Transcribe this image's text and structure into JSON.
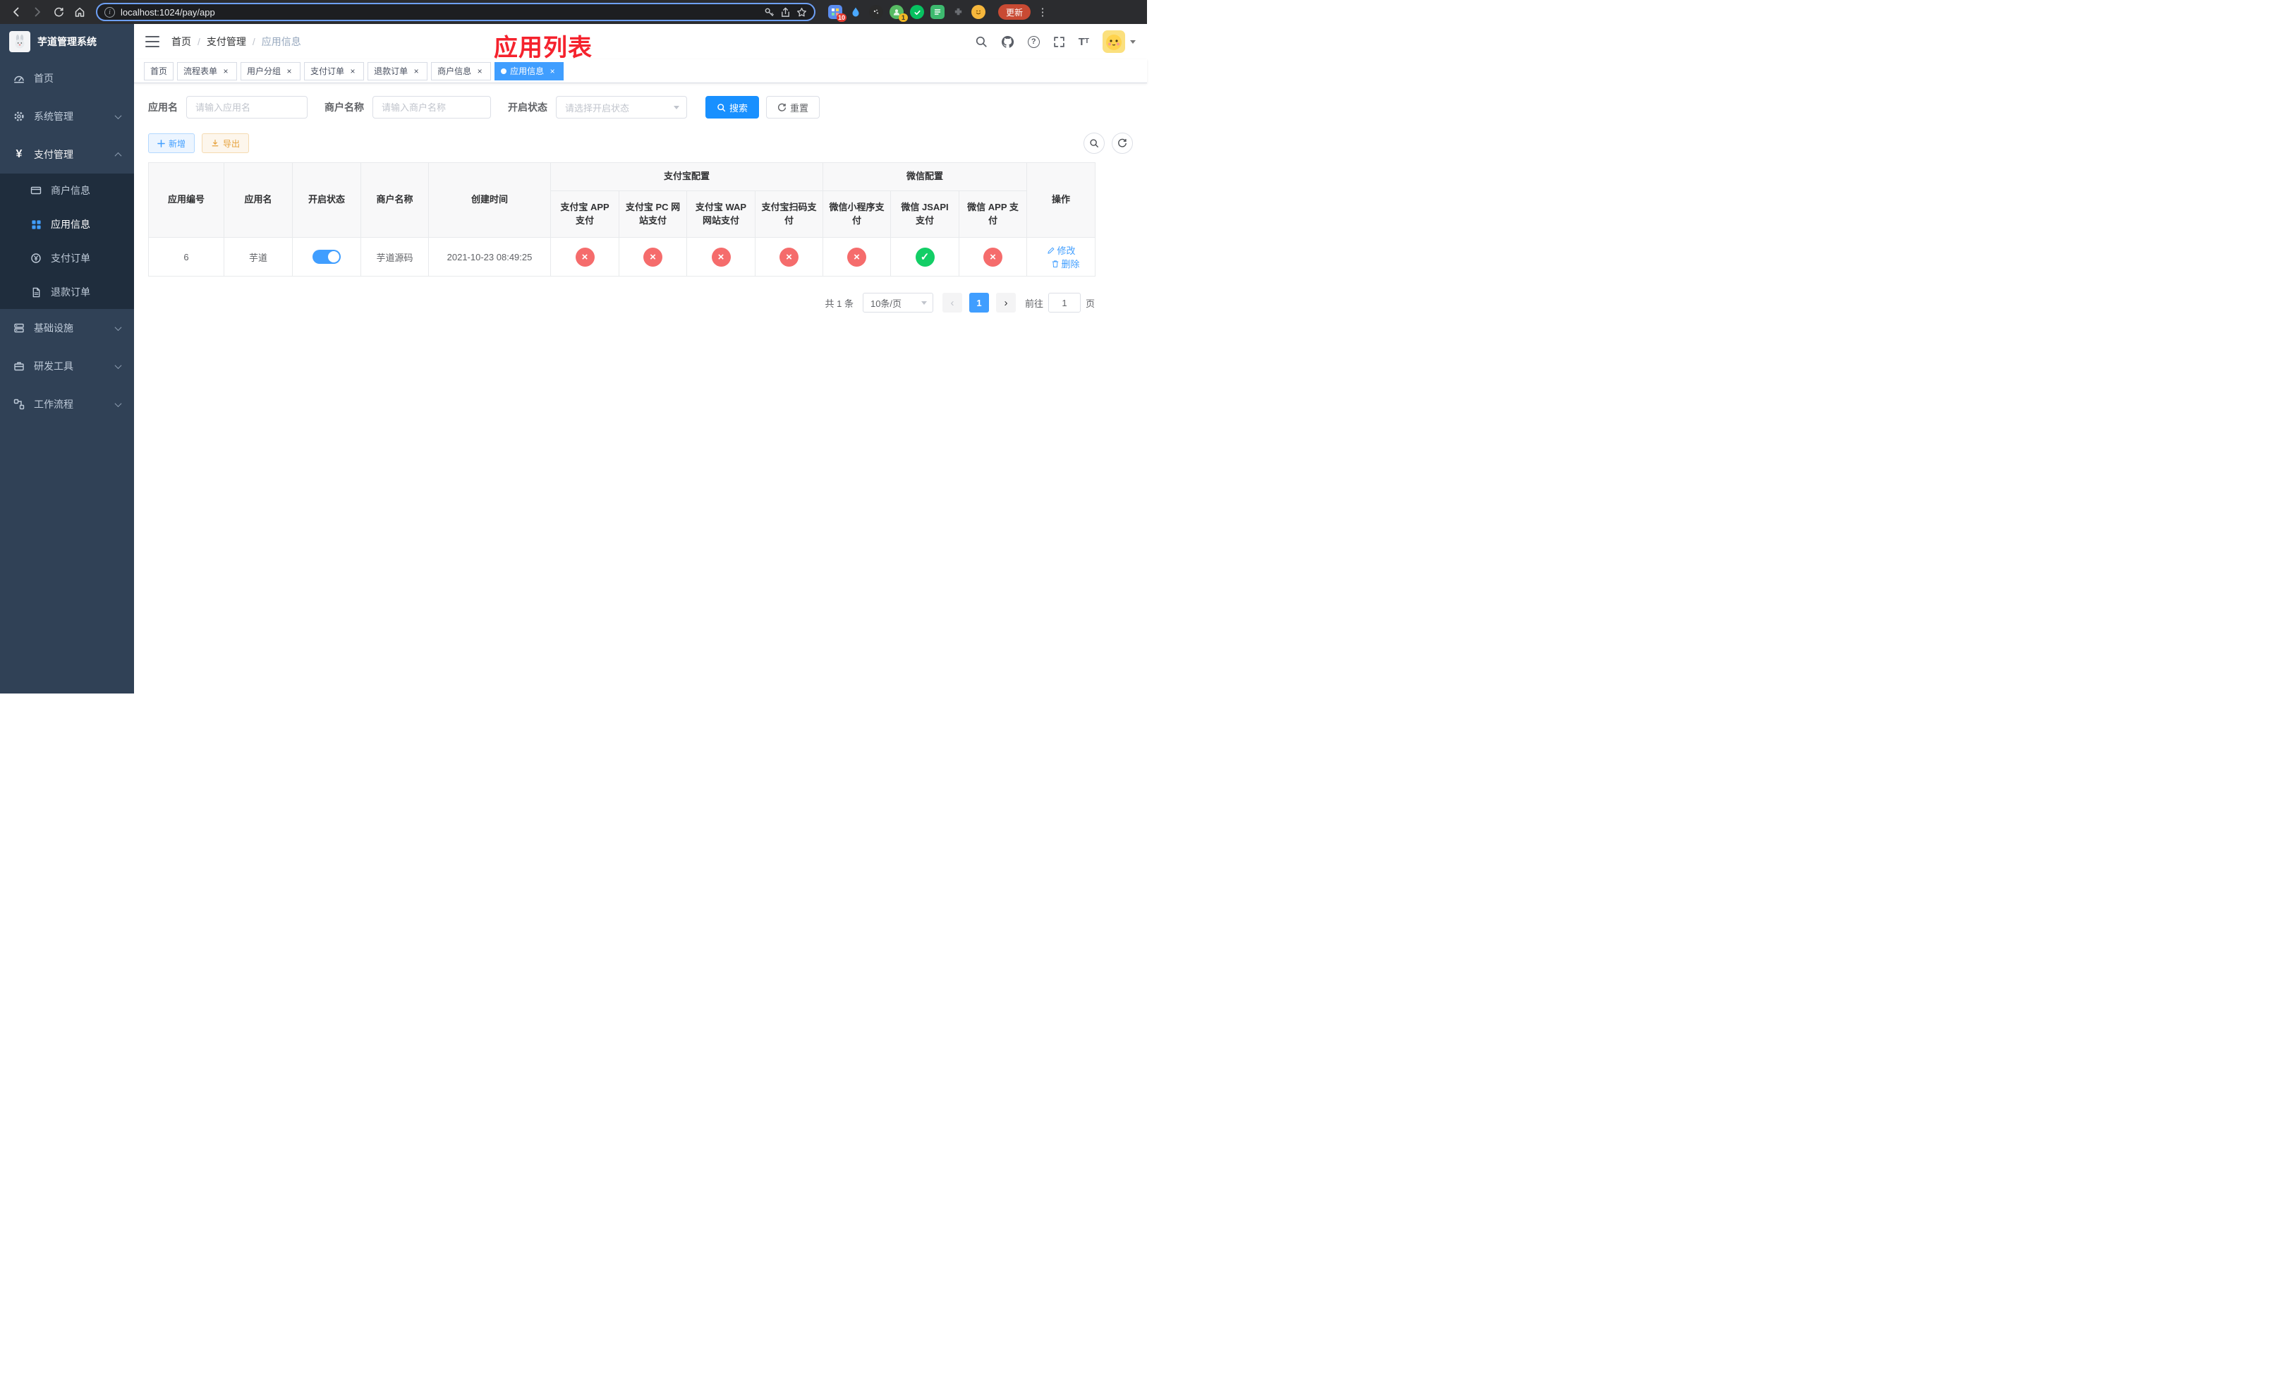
{
  "browser": {
    "url": "localhost:1024/pay/app",
    "update_label": "更新",
    "extension_badges": {
      "grid": "10",
      "avatar": "1"
    },
    "icons": [
      "back",
      "forward",
      "refresh",
      "home",
      "info",
      "key",
      "share",
      "bookmark-star",
      "extensions",
      "menu-kebab"
    ]
  },
  "sidebar": {
    "logo_title": "芋道管理系统",
    "menu": [
      {
        "label": "首页"
      },
      {
        "label": "系统管理"
      },
      {
        "label": "支付管理"
      },
      {
        "label": "商户信息"
      },
      {
        "label": "应用信息"
      },
      {
        "label": "支付订单"
      },
      {
        "label": "退款订单"
      },
      {
        "label": "基础设施"
      },
      {
        "label": "研发工具"
      },
      {
        "label": "工作流程"
      }
    ]
  },
  "header": {
    "breadcrumb": [
      "首页",
      "支付管理",
      "应用信息"
    ],
    "page_title": "应用列表",
    "right_icons": [
      "search",
      "github",
      "help",
      "fullscreen",
      "font-size",
      "avatar",
      "chevron-down"
    ]
  },
  "tabs": [
    {
      "label": "首页"
    },
    {
      "label": "流程表单"
    },
    {
      "label": "用户分组"
    },
    {
      "label": "支付订单"
    },
    {
      "label": "退款订单"
    },
    {
      "label": "商户信息"
    },
    {
      "label": "应用信息"
    }
  ],
  "filters": {
    "app_name_label": "应用名",
    "app_name_placeholder": "请输入应用名",
    "merchant_label": "商户名称",
    "merchant_placeholder": "请输入商户名称",
    "status_label": "开启状态",
    "status_placeholder": "请选择开启状态",
    "search_label": "搜索",
    "reset_label": "重置"
  },
  "toolbar": {
    "add_label": "新增",
    "export_label": "导出"
  },
  "table": {
    "groups": {
      "alipay": "支付宝配置",
      "wechat": "微信配置"
    },
    "headers": {
      "app_id": "应用编号",
      "app_name": "应用名",
      "status": "开启状态",
      "merchant": "商户名称",
      "create_time": "创建时间",
      "alipay_app": "支付宝 APP 支付",
      "alipay_pc": "支付宝 PC 网站支付",
      "alipay_wap": "支付宝 WAP 网站支付",
      "alipay_qr": "支付宝扫码支付",
      "wx_mini": "微信小程序支付",
      "wx_jsapi": "微信 JSAPI 支付",
      "wx_app": "微信 APP 支付",
      "actions": "操作"
    },
    "symbols": {
      "on": "✓",
      "off": "×"
    },
    "row": {
      "app_id": "6",
      "app_name": "芋道",
      "status_on": true,
      "merchant": "芋道源码",
      "create_time": "2021-10-23 08:49:25",
      "states": [
        "off",
        "off",
        "off",
        "off",
        "off",
        "on",
        "off"
      ],
      "edit_label": "修改",
      "delete_label": "删除"
    }
  },
  "pagination": {
    "total_text": "共 1 条",
    "page_size": "10条/页",
    "current_page": "1",
    "goto_label": "前往",
    "goto_value": "1",
    "goto_suffix": "页"
  },
  "colors": {
    "primary": "#409eff",
    "search_button": "#1890ff",
    "danger": "#f56c6c",
    "success": "#13ce66",
    "warning": "#e6a23c",
    "sidebar_bg": "#304156",
    "submenu_bg": "#1f2d3d",
    "title_red": "#f5222d"
  }
}
